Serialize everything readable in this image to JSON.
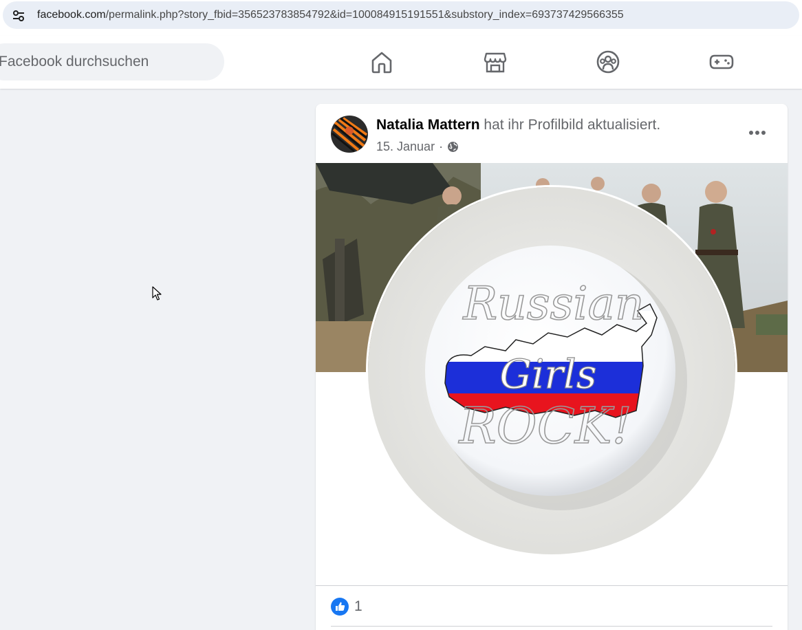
{
  "browser": {
    "url_host": "facebook.com",
    "url_path": "/permalink.php?story_fbid=356523783854792&id=100084915191551&substory_index=693737429566355",
    "site_info_icon": "tune-icon"
  },
  "header": {
    "search_placeholder": "Facebook durchsuchen",
    "nav": [
      {
        "name": "home",
        "icon": "home-icon"
      },
      {
        "name": "marketplace",
        "icon": "store-icon"
      },
      {
        "name": "groups",
        "icon": "groups-icon"
      },
      {
        "name": "gaming",
        "icon": "gamepad-icon"
      }
    ]
  },
  "post": {
    "author_name": "Natalia Mattern",
    "action_text": "hat ihr Profilbild aktualisiert.",
    "date": "15. Januar",
    "separator": "·",
    "privacy_icon": "globe-icon",
    "more_icon": "more-horizontal-icon",
    "profile_picture": {
      "text_line1": "Russian",
      "text_line2": "Girls",
      "text_line3": "ROCK!"
    },
    "reactions": {
      "type": "like",
      "count": "1"
    }
  },
  "colors": {
    "facebook_blue": "#1877f2",
    "background": "#f0f2f5",
    "flag_white": "#ffffff",
    "flag_blue": "#1c2fd9",
    "flag_red": "#e8141e"
  }
}
